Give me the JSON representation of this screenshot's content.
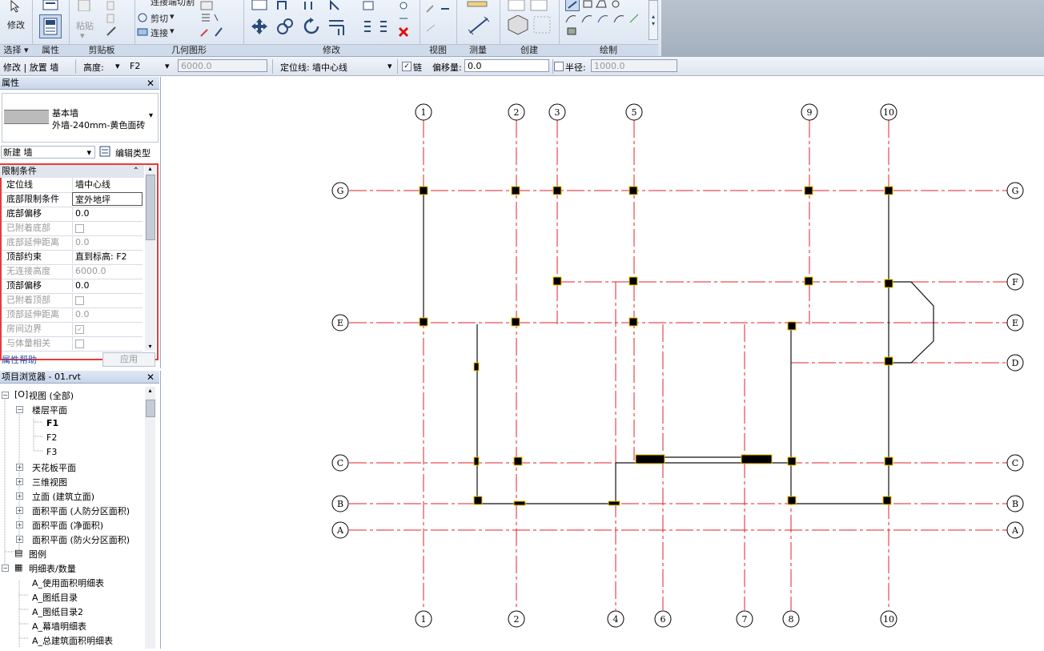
{
  "ribbon": {
    "modify_label": "修改",
    "groups": {
      "select": "选择 ▾",
      "properties": "属性",
      "clipboard": "剪贴板",
      "geometry": "几何图形",
      "modify": "修改",
      "view": "视图",
      "measure": "测量",
      "create": "创建",
      "draw": "绘制"
    },
    "clipboard": {
      "paste": "粘贴",
      "cut": "剪切",
      "join": "连接"
    },
    "geometry_top": "连接端切割"
  },
  "options_bar": {
    "context": "修改 | 放置 墙",
    "height_label": "高度:",
    "height_mode": "高度:",
    "level": "F2",
    "height_value": "6000.0",
    "location_line_label": "定位线:",
    "location_line": "墙中心线",
    "chain_label": "链",
    "chain_checked": "✓",
    "offset_label": "偏移量:",
    "offset_value": "0.0",
    "radius_label": "半径:",
    "radius_value": "1000.0"
  },
  "properties": {
    "title": "属性",
    "type_family": "基本墙",
    "type_name": "外墙-240mm-黄色面砖",
    "instance_selector": "新建 墙",
    "edit_type": "编辑类型",
    "section": "限制条件",
    "rows": [
      {
        "k": "定位线",
        "v": "墙中心线"
      },
      {
        "k": "底部限制条件",
        "v": "室外地坪"
      },
      {
        "k": "底部偏移",
        "v": "0.0"
      },
      {
        "k": "已附着底部",
        "v": ""
      },
      {
        "k": "底部延伸距离",
        "v": "0.0"
      },
      {
        "k": "顶部约束",
        "v": "直到标高: F2"
      },
      {
        "k": "无连接高度",
        "v": "6000.0"
      },
      {
        "k": "顶部偏移",
        "v": "0.0"
      },
      {
        "k": "已附着顶部",
        "v": ""
      },
      {
        "k": "顶部延伸距离",
        "v": "0.0"
      },
      {
        "k": "房间边界",
        "v": "✓"
      },
      {
        "k": "与体量相关",
        "v": ""
      }
    ],
    "help": "属性帮助",
    "apply": "应用"
  },
  "browser": {
    "title": "项目浏览器 - 01.rvt",
    "items": [
      "视图 (全部)",
      "楼层平面",
      "F1",
      "F2",
      "F3",
      "天花板平面",
      "三维视图",
      "立面 (建筑立面)",
      "面积平面 (人防分区面积)",
      "面积平面 (净面积)",
      "面积平面 (防火分区面积)",
      "图例",
      "明细表/数量",
      "A_使用面积明细表",
      "A_图纸目录",
      "A_图纸目录2",
      "A_幕墙明细表",
      "A_总建筑面积明细表"
    ]
  },
  "grids": {
    "top": [
      "1",
      "2",
      "3",
      "5",
      "9",
      "10"
    ],
    "bottom": [
      "1",
      "2",
      "4",
      "6",
      "7",
      "8",
      "10"
    ],
    "left": [
      "G",
      "E",
      "C",
      "B",
      "A"
    ],
    "right": [
      "G",
      "F",
      "E",
      "D",
      "C",
      "B",
      "A"
    ]
  },
  "colors": {
    "grid_line": "#e0202a",
    "ribbon_bg": "#dde6f2",
    "selection_highlight": "#e83a3a",
    "column_fill": "#000000",
    "column_outline": "#f2c200"
  }
}
